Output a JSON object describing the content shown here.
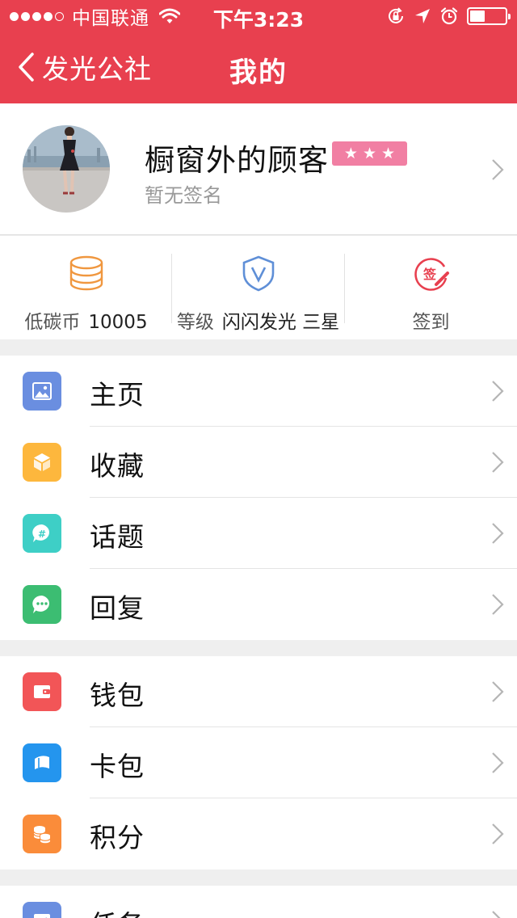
{
  "status_bar": {
    "carrier": "中国联通",
    "time": "下午3:23",
    "battery_level": 0.4
  },
  "nav": {
    "back_label": "发光公社",
    "title": "我的"
  },
  "profile": {
    "username": "橱窗外的顾客",
    "star_rating": 3,
    "signature": "暂无签名"
  },
  "stats": {
    "coins_label": "低碳币",
    "coins_value": "10005",
    "level_label": "等级",
    "level_value": "闪闪发光 三星",
    "checkin_label": "签到"
  },
  "menu_groups": [
    [
      {
        "label": "主页",
        "icon": "image-icon",
        "color": "#6a8ee0"
      },
      {
        "label": "收藏",
        "icon": "cube-icon",
        "color": "#fdb73d"
      },
      {
        "label": "话题",
        "icon": "hashtag-chat-icon",
        "color": "#3ecfc6"
      },
      {
        "label": "回复",
        "icon": "chat-bubble-icon",
        "color": "#3cbd72"
      }
    ],
    [
      {
        "label": "钱包",
        "icon": "wallet-icon",
        "color": "#f25557"
      },
      {
        "label": "卡包",
        "icon": "card-icon",
        "color": "#2495ee"
      },
      {
        "label": "积分",
        "icon": "coins-icon",
        "color": "#fa8c3a"
      }
    ],
    [
      {
        "label": "任务",
        "icon": "task-icon",
        "color": "#6a8ee0"
      }
    ]
  ],
  "colors": {
    "header_red": "#e8404f",
    "star_badge": "#f17fa3",
    "coin_orange": "#f0973f",
    "level_blue": "#5f8fd7",
    "checkin_red": "#e8404f"
  }
}
